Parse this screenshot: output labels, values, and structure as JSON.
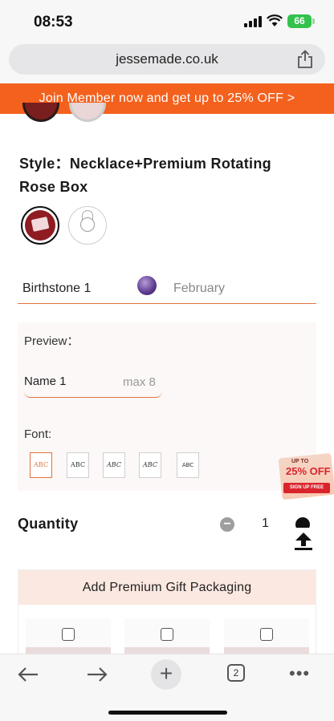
{
  "status_bar": {
    "time": "08:53",
    "battery": "66"
  },
  "browser": {
    "url": "jessemade.co.uk",
    "tab_count": "2"
  },
  "promo_banner": {
    "text": "Join Member now and get up to 25% OFF >"
  },
  "product": {
    "style_label": "Style：",
    "style_value": "Necklace+Premium Rotating Rose Box",
    "style_options": [
      {
        "name": "rotating-rose-box",
        "selected": true
      },
      {
        "name": "necklace-only",
        "selected": false
      }
    ],
    "birthstone": {
      "label": "Birthstone 1",
      "value": "February"
    },
    "preview": {
      "label": "Preview：",
      "name_field": {
        "label": "Name 1",
        "hint": "max 8"
      },
      "font_label": "Font:",
      "fonts": [
        "ABC",
        "ABC",
        "ABC",
        "ABC",
        "ABC"
      ]
    },
    "quantity": {
      "label": "Quantity",
      "value": "1"
    },
    "packaging": {
      "title": "Add Premium Gift Packaging"
    }
  },
  "promo_badge": {
    "top": "UP TO",
    "big": "25% OFF",
    "button": "SIGN UP FREE"
  },
  "colors": {
    "accent": "#f4611d",
    "field_underline": "#e2733f",
    "badge_red": "#d9242c"
  }
}
